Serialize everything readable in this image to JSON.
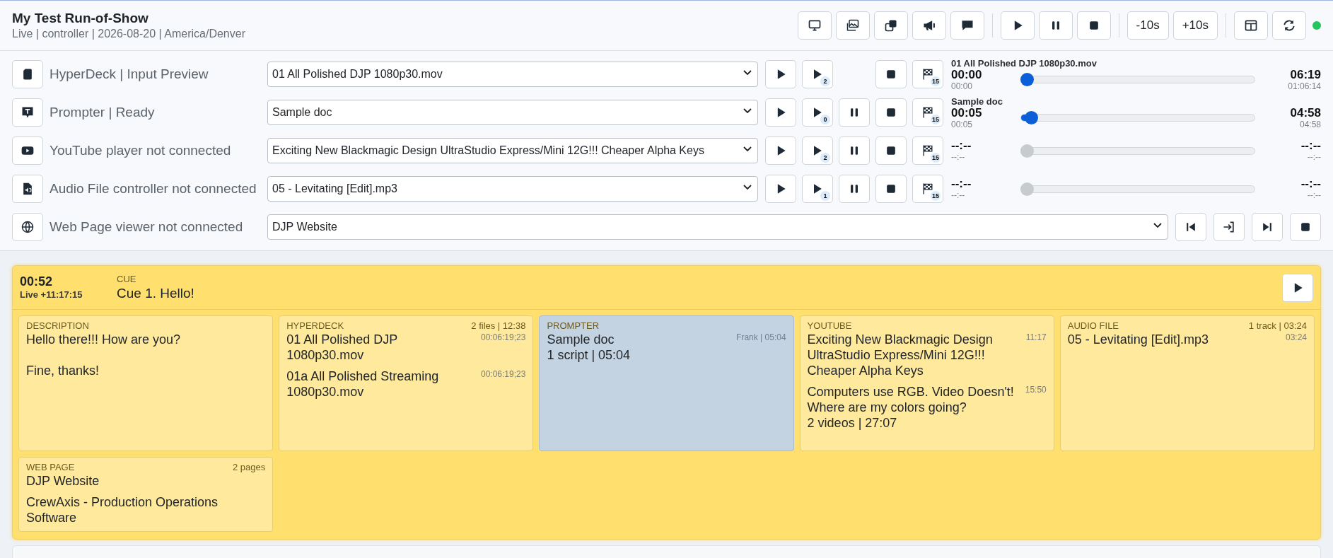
{
  "header": {
    "title": "My Test Run-of-Show",
    "subtitle": "Live | controller | 2026-08-20 | America/Denver",
    "toolbar": [
      {
        "buttons": [
          {
            "kind": "monitor"
          },
          {
            "kind": "images"
          },
          {
            "kind": "copy"
          },
          {
            "kind": "megaphone"
          },
          {
            "kind": "chat"
          }
        ]
      },
      {
        "buttons": [
          {
            "kind": "play"
          },
          {
            "kind": "pause"
          },
          {
            "kind": "stop"
          }
        ]
      },
      {
        "buttons": [
          {
            "kind": "text",
            "label": "-10s"
          },
          {
            "kind": "text",
            "label": "+10s"
          }
        ]
      },
      {
        "buttons": [
          {
            "kind": "layout"
          },
          {
            "kind": "refresh"
          }
        ]
      }
    ],
    "connected": true
  },
  "players": [
    {
      "kind": "hyperdeck",
      "label": "HyperDeck | Input Preview",
      "file": "01 All Polished DJP 1080p30.mov",
      "buttons": [
        {
          "kind": "play"
        },
        {
          "kind": "play-next",
          "badge": "2"
        },
        {
          "kind": "stop"
        },
        {
          "kind": "flag",
          "badge": "15"
        }
      ],
      "meter": {
        "title": "01 All Polished DJP 1080p30.mov",
        "elapsed": "00:00",
        "elapsed_sub": "00:00",
        "remaining": "06:19",
        "remaining_sub": "01:06:14",
        "level": 0,
        "disabled": false
      }
    },
    {
      "kind": "prompter",
      "label": "Prompter | Ready",
      "file": "Sample doc",
      "buttons": [
        {
          "kind": "play"
        },
        {
          "kind": "play-next",
          "badge": "0"
        },
        {
          "kind": "pause"
        },
        {
          "kind": "stop"
        },
        {
          "kind": "flag",
          "badge": "15"
        }
      ],
      "meter": {
        "title": "Sample doc",
        "elapsed": "00:05",
        "elapsed_sub": "00:05",
        "remaining": "04:58",
        "remaining_sub": "04:58",
        "level": 0.02,
        "disabled": false
      }
    },
    {
      "kind": "youtube",
      "label": "YouTube player not connected",
      "file": "Exciting New Blackmagic Design UltraStudio Express/Mini 12G!!! Cheaper Alpha Keys",
      "buttons": [
        {
          "kind": "play"
        },
        {
          "kind": "play-next",
          "badge": "2"
        },
        {
          "kind": "pause"
        },
        {
          "kind": "stop"
        },
        {
          "kind": "flag",
          "badge": "15"
        }
      ],
      "meter": {
        "elapsed": "--:--",
        "elapsed_sub": "--:--",
        "remaining": "--:--",
        "remaining_sub": "--:--",
        "level": 0,
        "disabled": true
      }
    },
    {
      "kind": "audio",
      "label": "Audio File controller not connected",
      "file": "05 - Levitating [Edit].mp3",
      "buttons": [
        {
          "kind": "play"
        },
        {
          "kind": "play-next",
          "badge": "1"
        },
        {
          "kind": "pause"
        },
        {
          "kind": "stop"
        },
        {
          "kind": "flag",
          "badge": "15"
        }
      ],
      "meter": {
        "elapsed": "--:--",
        "elapsed_sub": "--:--",
        "remaining": "--:--",
        "remaining_sub": "--:--",
        "level": 0,
        "disabled": true
      }
    },
    {
      "kind": "web",
      "label": "Web Page viewer not connected",
      "file": "DJP Website",
      "buttons": [
        {
          "kind": "skip-back"
        },
        {
          "kind": "enter"
        },
        {
          "kind": "skip-forward"
        },
        {
          "kind": "stop"
        }
      ]
    }
  ],
  "cue": {
    "time": "00:52",
    "live": "Live +11:17:15",
    "label": "CUE",
    "title": "Cue 1. Hello!",
    "cards": [
      {
        "kind": "text",
        "label": "DESCRIPTION",
        "active": false,
        "text": "Hello there!!! How are you?\n\nFine, thanks!"
      },
      {
        "kind": "list",
        "label": "HYPERDECK",
        "meta": "2 files | 12:38",
        "active": false,
        "items": [
          {
            "text": "01 All Polished DJP 1080p30.mov",
            "duration": "00:06:19;23"
          },
          {
            "text": "01a All Polished Streaming 1080p30.mov",
            "duration": "00:06:19;23"
          }
        ]
      },
      {
        "kind": "list",
        "label": "PROMPTER",
        "active": true,
        "items": [
          {
            "text": "Sample doc",
            "duration": "Frank | 05:04"
          }
        ],
        "footer": "1 script | 05:04"
      },
      {
        "kind": "list",
        "label": "YOUTUBE",
        "active": false,
        "items": [
          {
            "text": "Exciting New Blackmagic Design UltraStudio Express/Mini 12G!!! Cheaper Alpha Keys",
            "duration": "11:17"
          },
          {
            "text": "Computers use RGB. Video Doesn't! Where are my colors going?",
            "duration": "15:50"
          }
        ],
        "footer": "2 videos | 27:07"
      },
      {
        "kind": "list",
        "label": "AUDIO FILE",
        "meta": "1 track | 03:24",
        "active": false,
        "items": [
          {
            "text": "05 - Levitating [Edit].mp3",
            "duration": "03:24"
          }
        ]
      },
      {
        "kind": "list",
        "label": "WEB PAGE",
        "meta": "2 pages",
        "active": false,
        "items": [
          {
            "text": "DJP Website"
          },
          {
            "text": "CrewAxis - Production Operations Software"
          }
        ]
      }
    ]
  }
}
